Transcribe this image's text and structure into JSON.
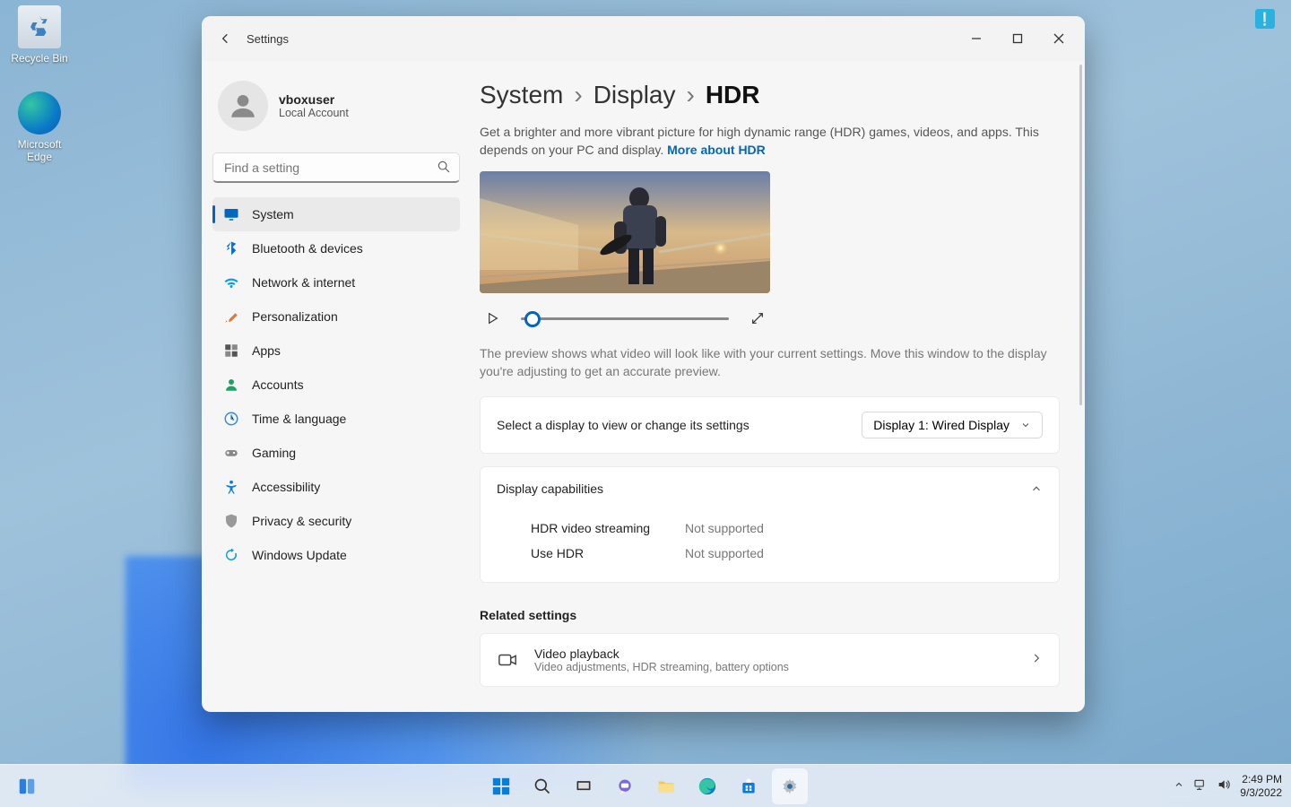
{
  "desktop": {
    "recycle_bin": "Recycle Bin",
    "edge": "Microsoft Edge"
  },
  "window": {
    "title": "Settings",
    "user": {
      "name": "vboxuser",
      "sub": "Local Account"
    },
    "search_placeholder": "Find a setting",
    "nav": [
      {
        "label": "System"
      },
      {
        "label": "Bluetooth & devices"
      },
      {
        "label": "Network & internet"
      },
      {
        "label": "Personalization"
      },
      {
        "label": "Apps"
      },
      {
        "label": "Accounts"
      },
      {
        "label": "Time & language"
      },
      {
        "label": "Gaming"
      },
      {
        "label": "Accessibility"
      },
      {
        "label": "Privacy & security"
      },
      {
        "label": "Windows Update"
      }
    ],
    "breadcrumb": {
      "a": "System",
      "b": "Display",
      "c": "HDR"
    },
    "description": "Get a brighter and more vibrant picture for high dynamic range (HDR) games, videos, and apps. This depends on your PC and display. ",
    "more_link": "More about HDR",
    "preview_hint": "The preview shows what video will look like with your current settings. Move this window to the display you're adjusting to get an accurate preview.",
    "select_display": {
      "label": "Select a display to view or change its settings",
      "value": "Display 1: Wired Display"
    },
    "capabilities": {
      "title": "Display capabilities",
      "rows": [
        {
          "k": "HDR video streaming",
          "v": "Not supported"
        },
        {
          "k": "Use HDR",
          "v": "Not supported"
        }
      ]
    },
    "related_title": "Related settings",
    "video_playback": {
      "title": "Video playback",
      "sub": "Video adjustments, HDR streaming, battery options"
    }
  },
  "taskbar": {
    "time": "2:49 PM",
    "date": "9/3/2022"
  }
}
